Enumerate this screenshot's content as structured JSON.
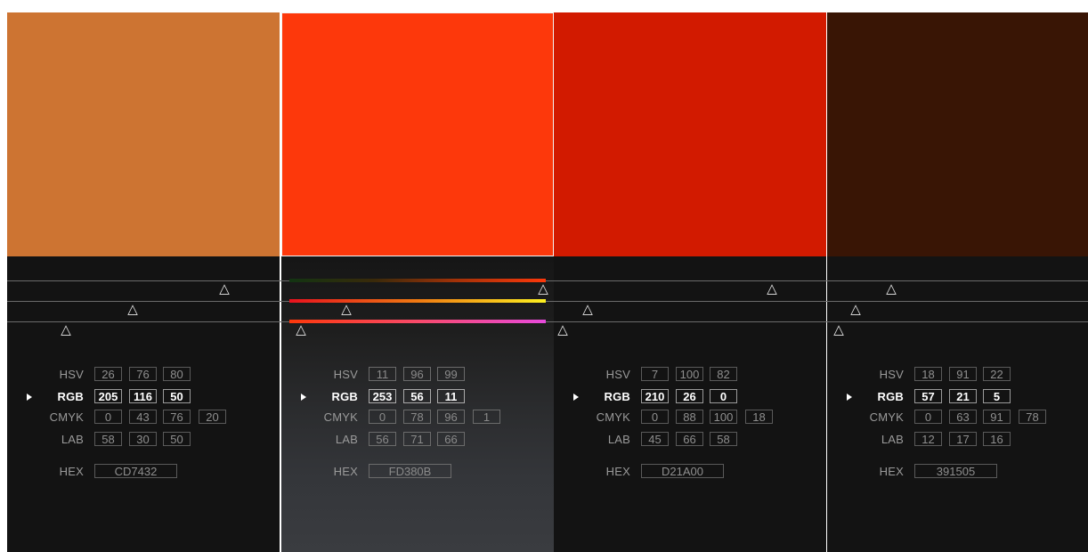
{
  "palette": [
    {
      "hex": "CD7432",
      "color": "#CD7432",
      "hsv": [
        "26",
        "76",
        "80"
      ],
      "rgb": [
        "205",
        "116",
        "50"
      ],
      "cmyk": [
        "0",
        "43",
        "76",
        "20"
      ],
      "lab": [
        "58",
        "30",
        "50"
      ],
      "selected": false
    },
    {
      "hex": "FD380B",
      "color": "#FD380B",
      "hsv": [
        "11",
        "96",
        "99"
      ],
      "rgb": [
        "253",
        "56",
        "11"
      ],
      "cmyk": [
        "0",
        "78",
        "96",
        "1"
      ],
      "lab": [
        "56",
        "71",
        "66"
      ],
      "selected": true
    },
    {
      "hex": "D21A00",
      "color": "#D21A00",
      "hsv": [
        "7",
        "100",
        "82"
      ],
      "rgb": [
        "210",
        "26",
        "0"
      ],
      "cmyk": [
        "0",
        "88",
        "100",
        "18"
      ],
      "lab": [
        "45",
        "66",
        "58"
      ],
      "selected": false
    },
    {
      "hex": "391505",
      "color": "#391505",
      "hsv": [
        "18",
        "91",
        "22"
      ],
      "rgb": [
        "57",
        "21",
        "5"
      ],
      "cmyk": [
        "0",
        "63",
        "91",
        "78"
      ],
      "lab": [
        "12",
        "17",
        "16"
      ],
      "selected": false
    }
  ],
  "labels": {
    "hsv": "HSV",
    "rgb": "RGB",
    "cmyk": "CMYK",
    "lab": "LAB",
    "hex": "HEX"
  },
  "active_mode": "RGB",
  "colors": {
    "panel_bg": "#131313",
    "rail": "#6b6b6b",
    "handle": "#e8e8e8"
  }
}
